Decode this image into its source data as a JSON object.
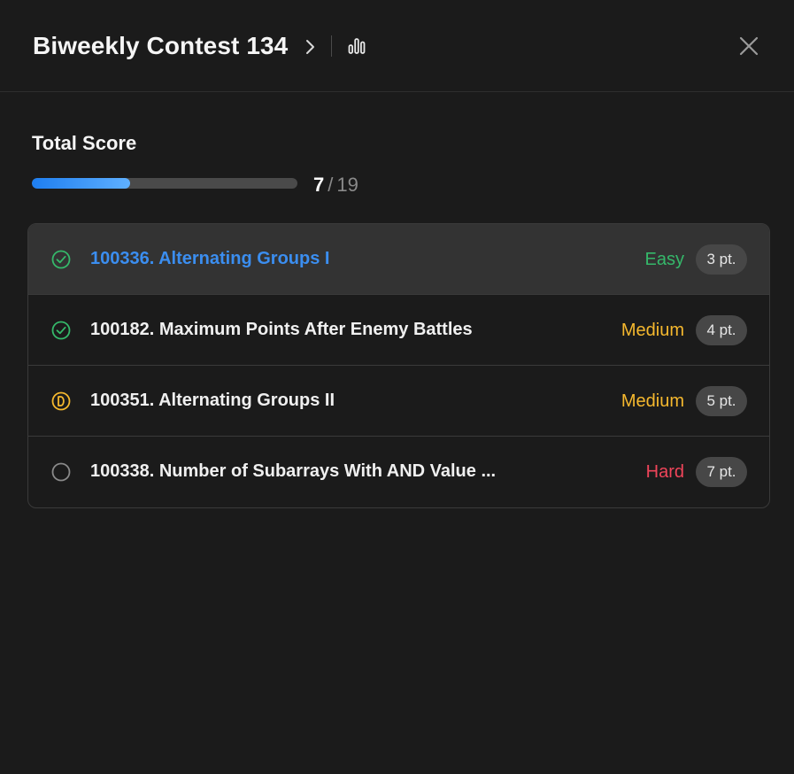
{
  "header": {
    "title": "Biweekly Contest 134"
  },
  "score": {
    "label": "Total Score",
    "current": "7",
    "separator": "/",
    "total": "19",
    "progress_fraction": 0.37
  },
  "colors": {
    "accent_blue": "#3b8ef0",
    "easy": "#35b86a",
    "medium": "#f5b82e",
    "hard": "#f0455a",
    "background": "#1b1b1b"
  },
  "problems": [
    {
      "title": "100336. Alternating Groups I",
      "difficulty": "Easy",
      "points": "3 pt.",
      "status_icon": "check-circle-icon"
    },
    {
      "title": "100182. Maximum Points After Enemy Battles",
      "difficulty": "Medium",
      "points": "4 pt.",
      "status_icon": "check-circle-icon"
    },
    {
      "title": "100351. Alternating Groups II",
      "difficulty": "Medium",
      "points": "5 pt.",
      "status_icon": "attempted-circle-icon"
    },
    {
      "title": "100338. Number of Subarrays With AND Value ...",
      "difficulty": "Hard",
      "points": "7 pt.",
      "status_icon": "empty-circle-icon"
    }
  ]
}
